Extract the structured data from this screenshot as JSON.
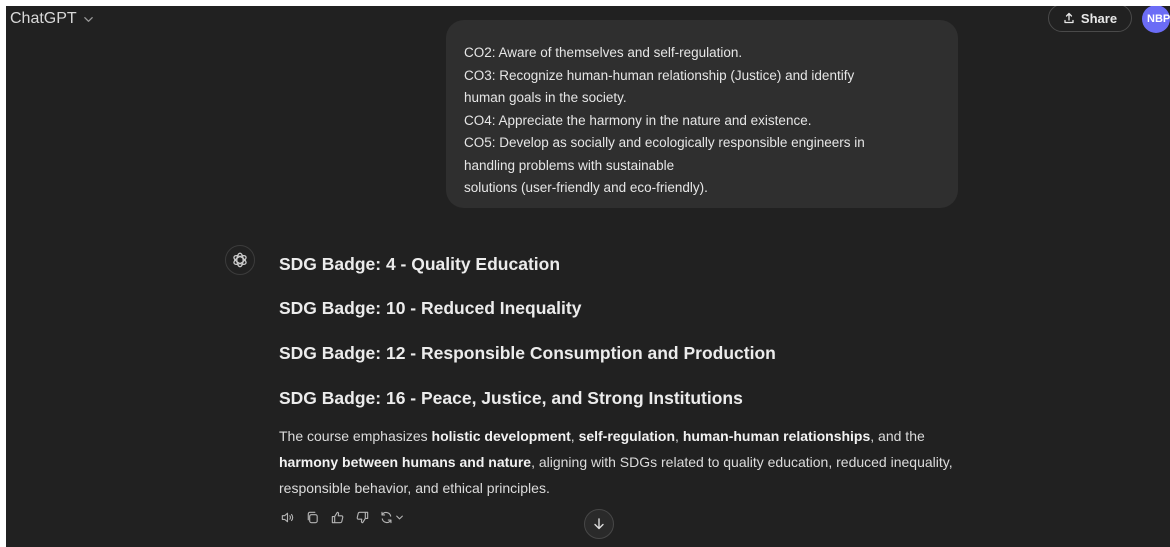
{
  "header": {
    "model_name": "ChatGPT",
    "share_label": "Share",
    "avatar_initials": "NBP"
  },
  "user_message": {
    "lines": [
      "CO2: Aware of themselves and self-regulation.",
      "CO3: Recognize human-human relationship (Justice) and identify",
      "human goals in the society.",
      "CO4: Appreciate the harmony in the nature and existence.",
      "CO5: Develop as socially and ecologically responsible engineers in",
      "handling problems with sustainable",
      "solutions (user-friendly and eco-friendly)."
    ]
  },
  "assistant_message": {
    "headings": [
      "SDG Badge: 4 - Quality Education",
      "SDG Badge: 10 - Reduced Inequality",
      "SDG Badge: 12 - Responsible Consumption and Production",
      "SDG Badge: 16 - Peace, Justice, and Strong Institutions"
    ],
    "summary": {
      "p1": "The course emphasizes ",
      "b1": "holistic development",
      "p2": ", ",
      "b2": "self-regulation",
      "p3": ", ",
      "b3": "human-human relationships",
      "p4": ", and the ",
      "b4": "harmony between humans and nature",
      "p5": ", aligning with SDGs related to quality education, reduced inequality, responsible behavior, and ethical principles."
    }
  },
  "icons": {
    "model_chevron": "chevron-down-icon",
    "share": "share-icon",
    "assistant": "openai-logo-icon",
    "read_aloud": "speaker-icon",
    "copy": "copy-icon",
    "good": "thumbs-up-icon",
    "bad": "thumbs-down-icon",
    "regenerate": "refresh-icon",
    "scroll": "arrow-down-icon"
  },
  "colors": {
    "background": "#212121",
    "user_bubble": "#2f2f2f",
    "avatar": "#6b6cf6",
    "text": "#ececec"
  }
}
